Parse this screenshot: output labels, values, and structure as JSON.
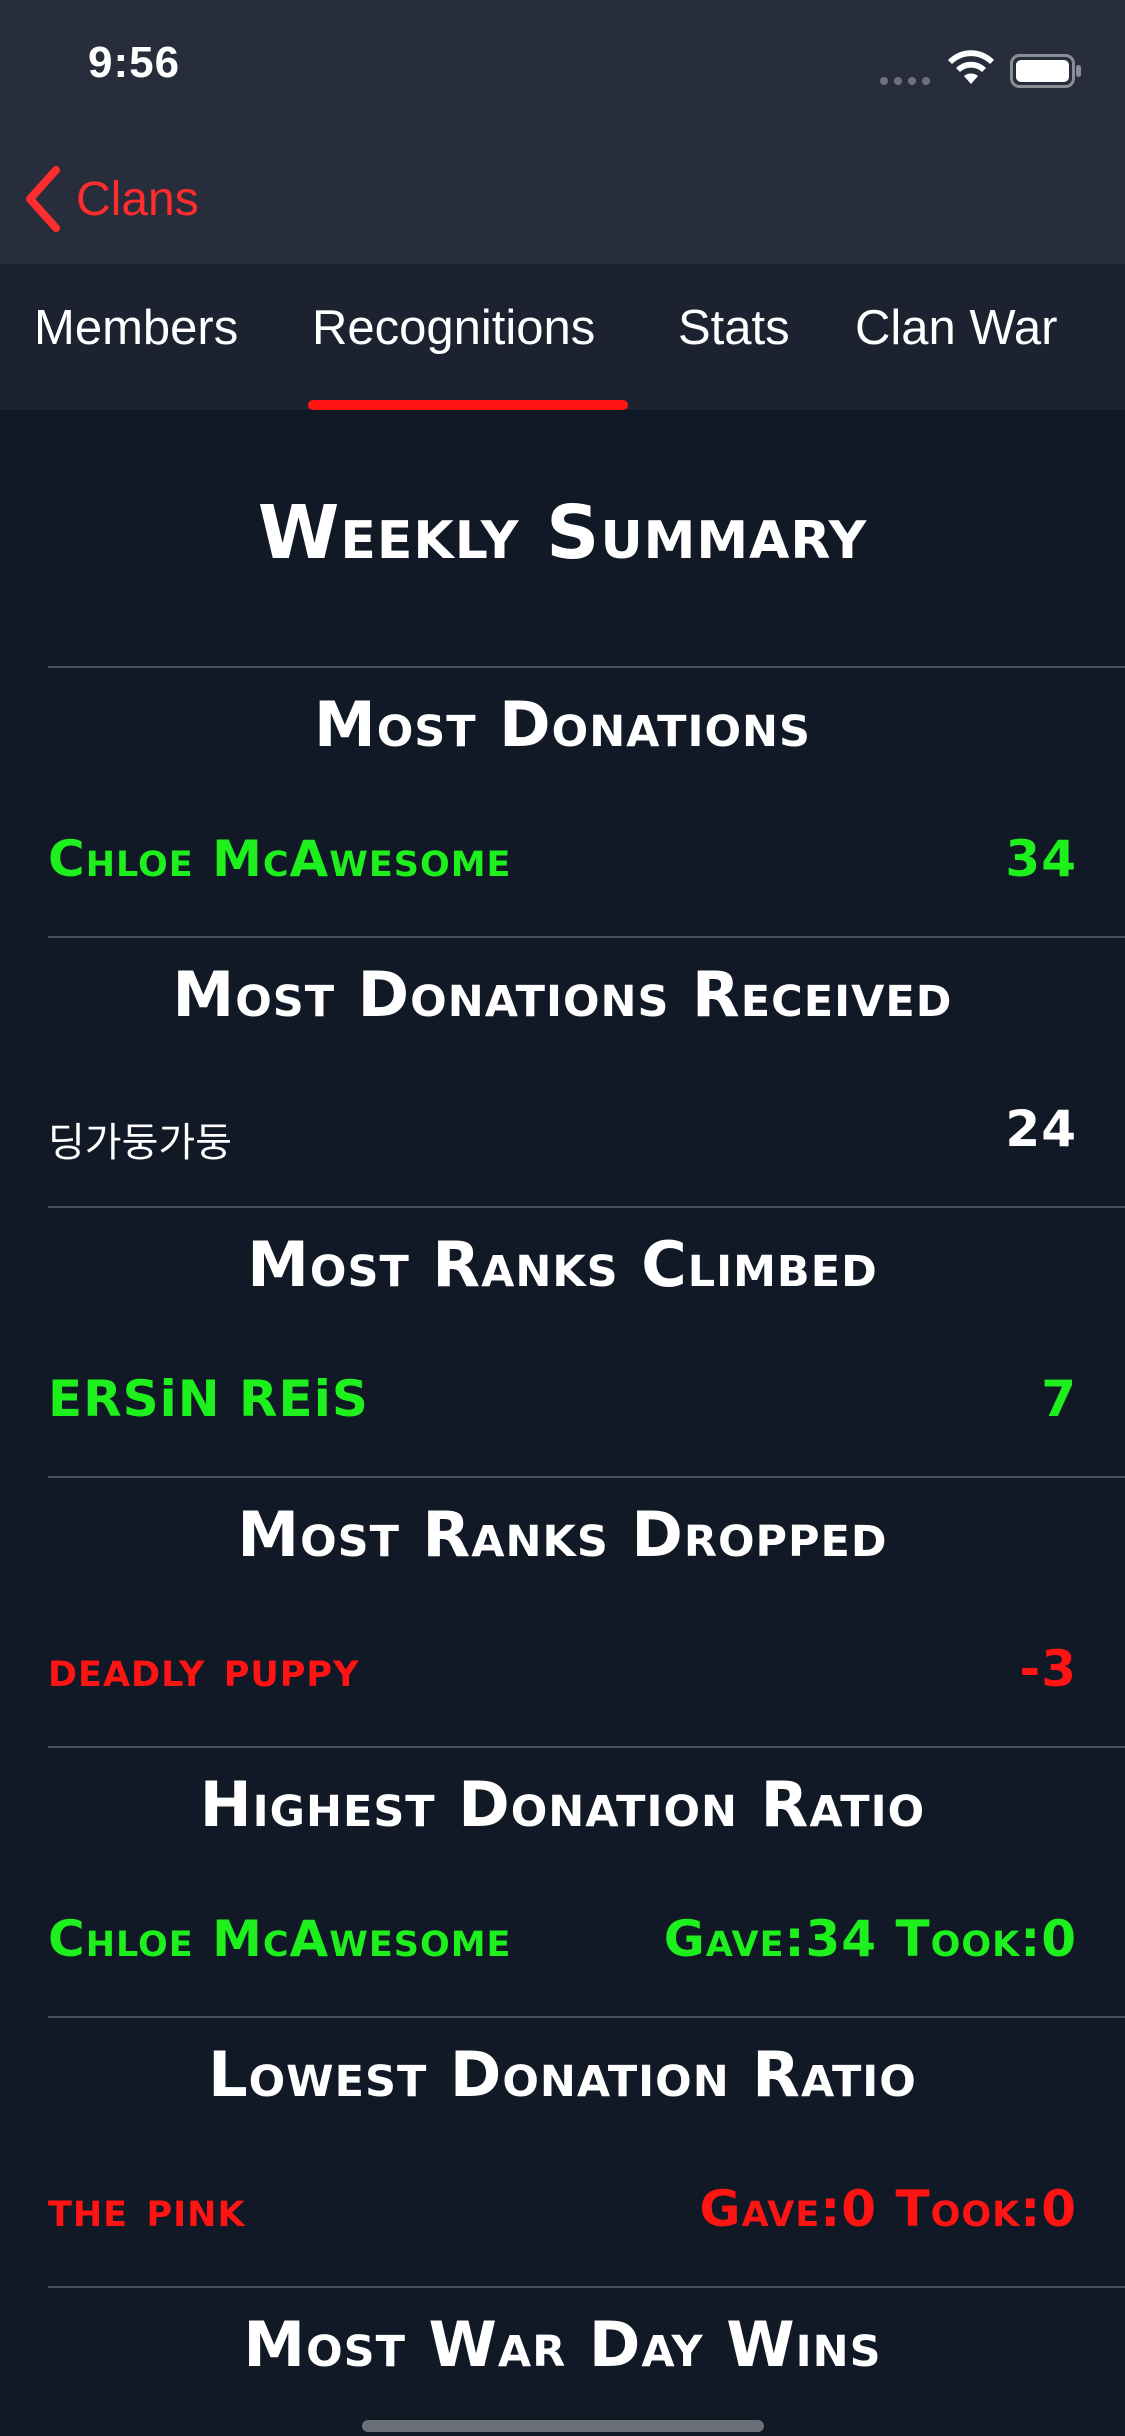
{
  "status_bar": {
    "time": "9:56",
    "signal_icon": "cellular-signal-icon",
    "wifi_icon": "wifi-icon",
    "battery_icon": "battery-icon"
  },
  "nav": {
    "back_icon": "chevron-left-icon",
    "back_label": "Clans"
  },
  "tabs": [
    {
      "label": "Members",
      "selected": false
    },
    {
      "label": "Recognitions",
      "selected": true
    },
    {
      "label": "Stats",
      "selected": false
    },
    {
      "label": "Clan War",
      "selected": false
    }
  ],
  "page": {
    "title": "Weekly Summary"
  },
  "sections": [
    {
      "title": "Most Donations",
      "name": "Chloe McAwesome",
      "value": "34",
      "color": "#1ef01e"
    },
    {
      "title": "Most Donations Received",
      "name": "딩가둥가둥",
      "value": "24",
      "color": "#ffffff"
    },
    {
      "title": "Most Ranks Climbed",
      "name": "ERSiN REiS",
      "value": "7",
      "color": "#1ef01e"
    },
    {
      "title": "Most Ranks Dropped",
      "name": "deadly puppy",
      "value": "-3",
      "color": "#ff1414"
    },
    {
      "title": "Highest Donation Ratio",
      "name": "Chloe McAwesome",
      "value": "Gave:34 Took:0",
      "color": "#1ef01e"
    },
    {
      "title": "Lowest Donation Ratio",
      "name": "the pink",
      "value": "Gave:0 Took:0",
      "color": "#ff1414"
    },
    {
      "title": "Most War Day Wins"
    }
  ],
  "colors": {
    "accent": "#ff1414",
    "positive": "#1ef01e",
    "background": "#111826",
    "header": "#272d3a"
  }
}
